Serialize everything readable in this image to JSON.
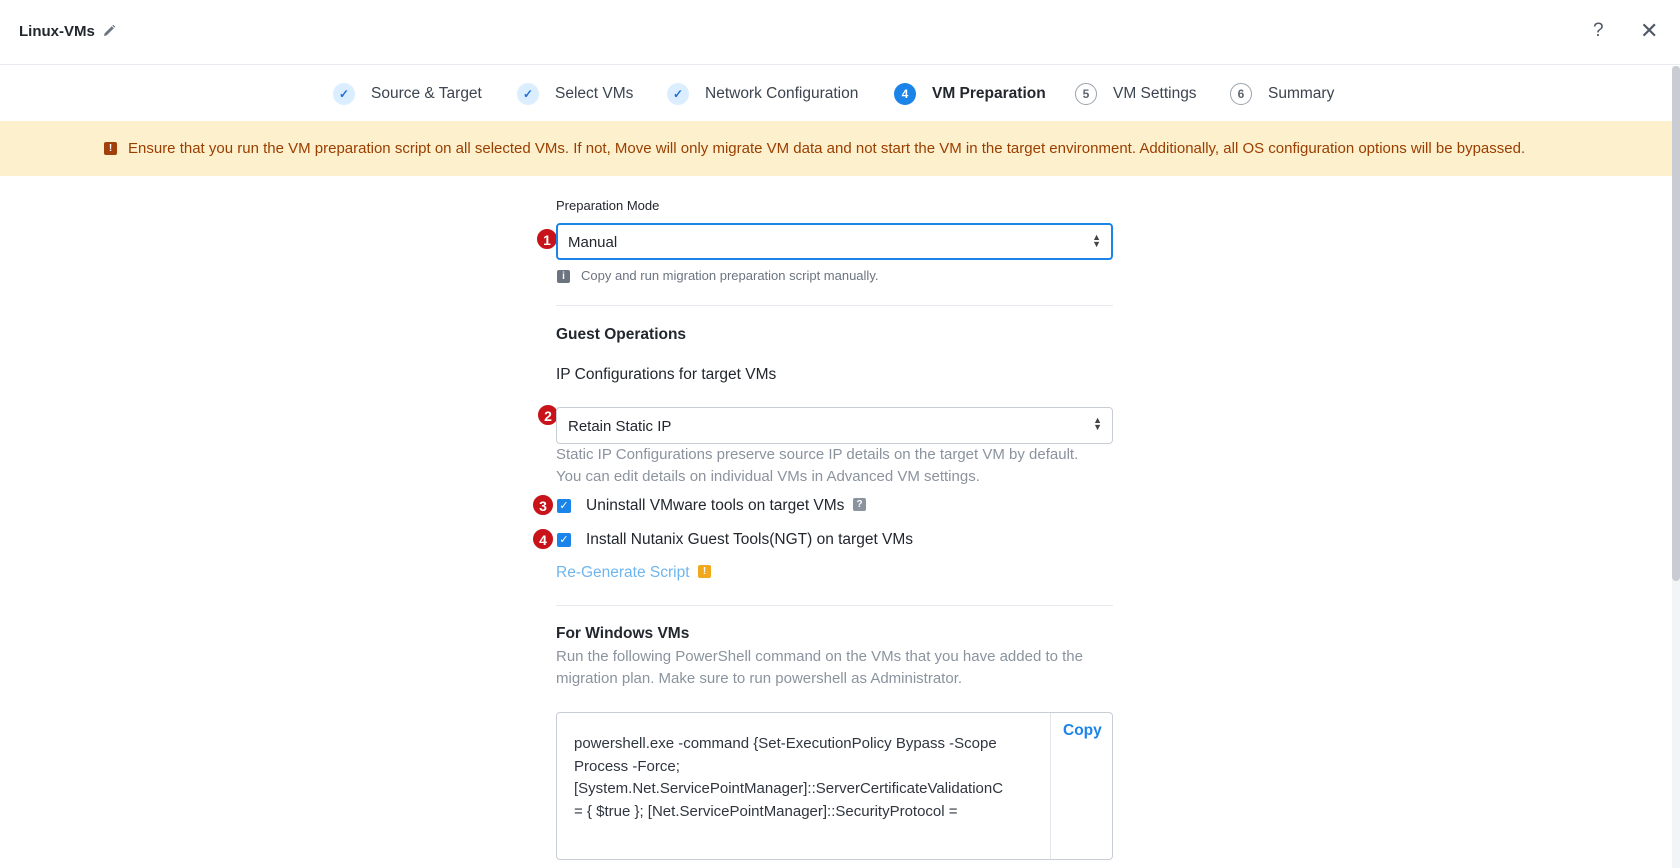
{
  "header": {
    "title": "Linux-VMs",
    "help_label": "?",
    "close_label": "✕"
  },
  "stepper": {
    "steps": [
      {
        "number": "✓",
        "label": "Source & Target",
        "state": "done"
      },
      {
        "number": "✓",
        "label": "Select VMs",
        "state": "done"
      },
      {
        "number": "✓",
        "label": "Network Configuration",
        "state": "done"
      },
      {
        "number": "4",
        "label": "VM Preparation",
        "state": "active"
      },
      {
        "number": "5",
        "label": "VM Settings",
        "state": "todo"
      },
      {
        "number": "6",
        "label": "Summary",
        "state": "todo"
      }
    ]
  },
  "banner": {
    "icon": "!",
    "text": "Ensure that you run the VM preparation script on all selected VMs. If not, Move will only migrate VM data and not start the VM in the target environment. Additionally, all OS configuration options will be bypassed."
  },
  "form": {
    "preparation_mode_label": "Preparation Mode",
    "preparation_mode_value": "Manual",
    "preparation_mode_hint": "Copy and run migration preparation script manually.",
    "guest_operations_title": "Guest Operations",
    "ip_config_label": "IP Configurations for target VMs",
    "ip_config_value": "Retain Static IP",
    "ip_config_hint_line1": "Static IP Configurations preserve source IP details on the target VM by default.",
    "ip_config_hint_line2": "You can edit details on individual VMs in Advanced VM settings.",
    "uninstall_vmware_label": "Uninstall VMware tools on target VMs",
    "uninstall_vmware_checked": true,
    "install_ngt_label": "Install Nutanix Guest Tools(NGT) on target VMs",
    "install_ngt_checked": true,
    "regenerate_label": "Re-Generate Script",
    "windows_title": "For Windows VMs",
    "windows_desc_line1": "Run the following PowerShell command on the VMs that you have added to the",
    "windows_desc_line2": "migration plan. Make sure to run powershell as Administrator.",
    "code_line1": "powershell.exe -command {Set-ExecutionPolicy Bypass -Scope",
    "code_line2": "Process -Force;",
    "code_line3": "[System.Net.ServicePointManager]::ServerCertificateValidationC",
    "code_line4": "= { $true }; [Net.ServicePointManager]::SecurityProtocol =",
    "copy_label": "Copy"
  },
  "annotations": {
    "badge1": "1",
    "badge2": "2",
    "badge3": "3",
    "badge4": "4",
    "badge_color": "#c8131a"
  },
  "colors": {
    "accent": "#1b84e8",
    "banner_bg": "#fdf0cd",
    "banner_text": "#9a3e00"
  }
}
